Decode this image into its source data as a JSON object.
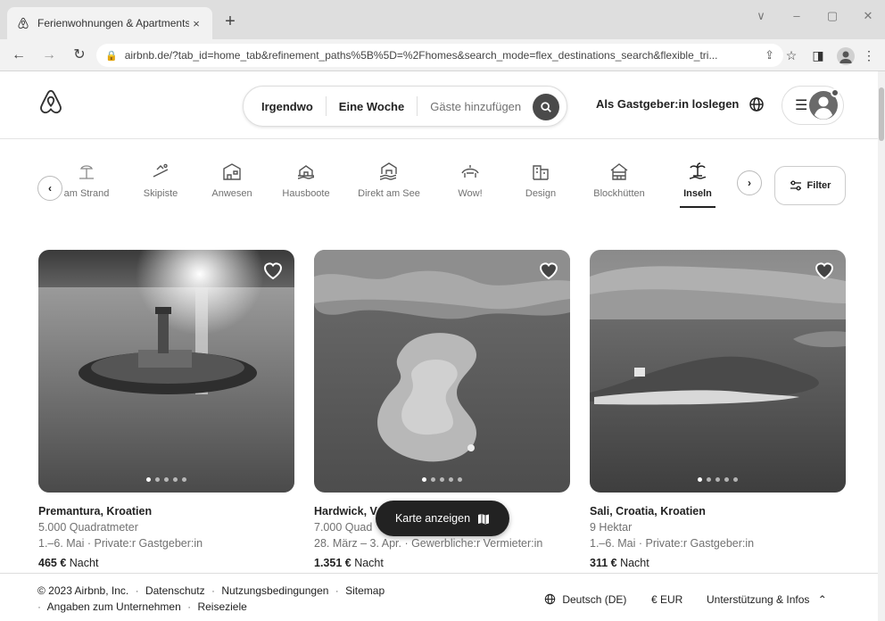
{
  "browser": {
    "tab_title": "Ferienwohnungen & Apartments",
    "tab_close": "×",
    "new_tab": "+",
    "window_controls": [
      "∨",
      "–",
      "▢",
      "✕"
    ],
    "url": "airbnb.de/?tab_id=home_tab&refinement_paths%5B%5D=%2Fhomes&search_mode=flex_destinations_search&flexible_tri..."
  },
  "header": {
    "search": {
      "where": "Irgendwo",
      "when": "Eine Woche",
      "guests": "Gäste hinzufügen"
    },
    "host_link": "Als Gastgeber:in loslegen"
  },
  "categories": [
    {
      "label": "am Strand",
      "icon": "beach-icon"
    },
    {
      "label": "Skipiste",
      "icon": "ski-icon"
    },
    {
      "label": "Anwesen",
      "icon": "mansion-icon"
    },
    {
      "label": "Hausboote",
      "icon": "houseboat-icon"
    },
    {
      "label": "Direkt am See",
      "icon": "lakefront-icon"
    },
    {
      "label": "Wow!",
      "icon": "wow-icon"
    },
    {
      "label": "Design",
      "icon": "design-icon"
    },
    {
      "label": "Blockhütten",
      "icon": "cabin-icon"
    },
    {
      "label": "Inseln",
      "icon": "island-icon",
      "active": true
    }
  ],
  "filter_label": "Filter",
  "listings": [
    {
      "title": "Premantura, Kroatien",
      "area": "5.000 Quadratmeter",
      "details": "1.–6. Mai · Private:r Gastgeber:in",
      "price": "465 €",
      "price_unit": "Nacht"
    },
    {
      "title": "Hardwick, V",
      "area": "7.000 Quad",
      "details": "28. März – 3. Apr. · Gewerbliche:r Vermieter:in",
      "price": "1.351 €",
      "price_unit": "Nacht"
    },
    {
      "title": "Sali, Croatia, Kroatien",
      "area": "9 Hektar",
      "details": "1.–6. Mai · Private:r Gastgeber:in",
      "price": "311 €",
      "price_unit": "Nacht"
    }
  ],
  "map_button": "Karte anzeigen",
  "footer": {
    "copyright": "© 2023 Airbnb, Inc.",
    "links_row1": [
      "Datenschutz",
      "Nutzungsbedingungen",
      "Sitemap"
    ],
    "links_row2": [
      "Angaben zum Unternehmen",
      "Reiseziele"
    ],
    "separator": "·",
    "language": "Deutsch (DE)",
    "currency": "€  EUR",
    "support": "Unterstützung & Infos"
  }
}
